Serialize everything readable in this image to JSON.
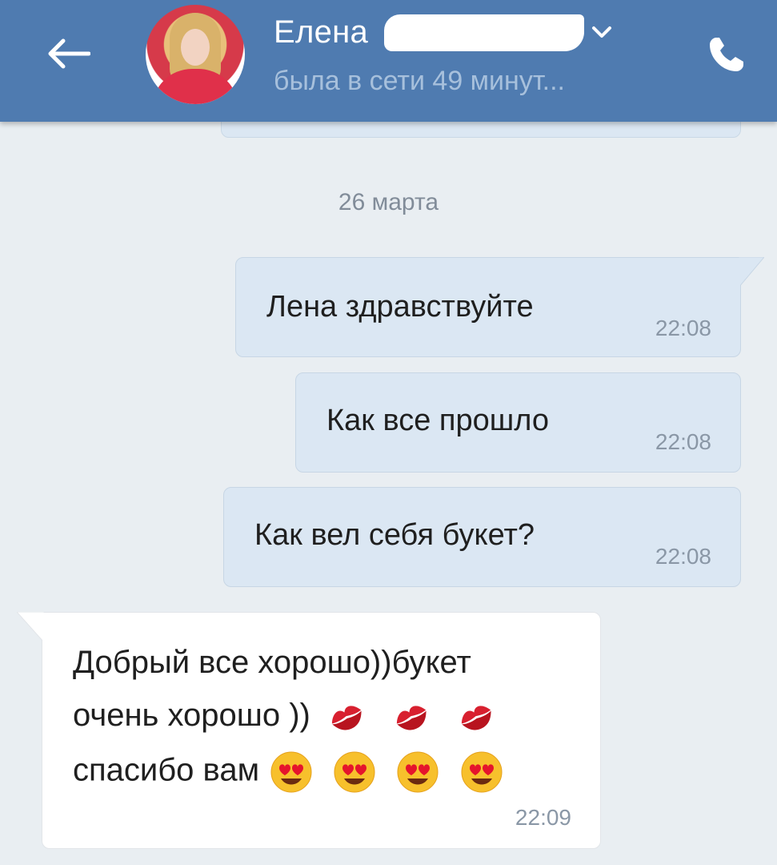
{
  "header": {
    "back_icon": "arrow-left-icon",
    "contact_name": "Елена",
    "status": "была в сети 49 минут...",
    "call_icon": "phone-icon",
    "chevron_icon": "chevron-down-icon",
    "bg_color": "#4f7bb0"
  },
  "chat": {
    "date_separator": "26 марта",
    "messages": [
      {
        "direction": "out",
        "text": "Лена здравствуйте",
        "time": "22:08"
      },
      {
        "direction": "out",
        "text": "Как все прошло",
        "time": "22:08"
      },
      {
        "direction": "out",
        "text": "Как вел себя букет?",
        "time": "22:08"
      },
      {
        "direction": "in",
        "lines": [
          "Добрый все хорошо))букет",
          "очень хорошо ))",
          "спасибо вам"
        ],
        "emoji_line2": [
          "kiss-mark-icon",
          "kiss-mark-icon",
          "kiss-mark-icon"
        ],
        "emoji_line3": [
          "heart-eyes-icon",
          "heart-eyes-icon",
          "heart-eyes-icon",
          "heart-eyes-icon"
        ],
        "time": "22:09"
      }
    ]
  },
  "colors": {
    "outgoing_bubble": "#dbe7f3",
    "incoming_bubble": "#ffffff",
    "chat_background": "#e9eef2"
  }
}
